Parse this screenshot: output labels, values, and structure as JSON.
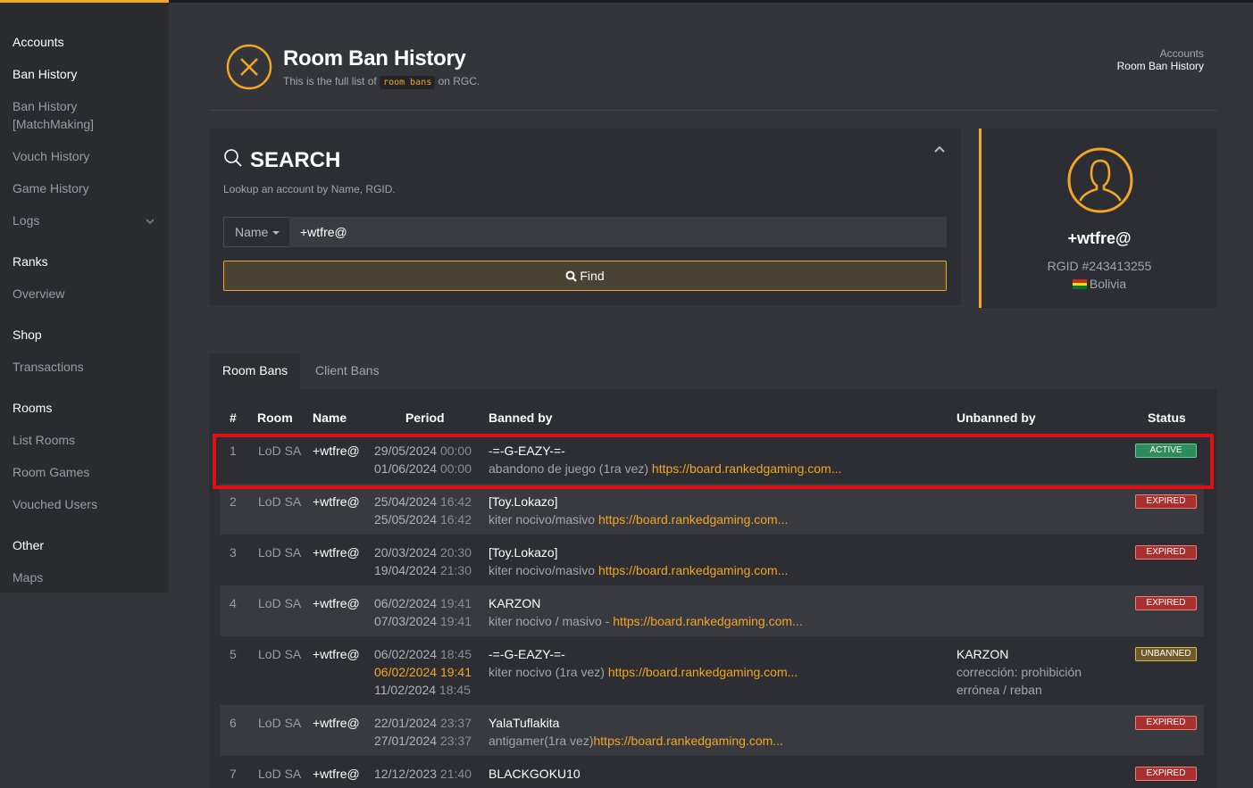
{
  "sidebar": {
    "groups": [
      {
        "heading": "Accounts",
        "items": [
          "Ban History",
          "Ban History\n[MatchMaking]",
          "Vouch History",
          "Game History",
          "Logs"
        ]
      },
      {
        "heading": "Ranks",
        "items": [
          "Overview"
        ]
      },
      {
        "heading": "Shop",
        "items": [
          "Transactions"
        ]
      },
      {
        "heading": "Rooms",
        "items": [
          "List Rooms",
          "Room Games",
          "Vouched Users"
        ]
      },
      {
        "heading": "Other",
        "items": [
          "Maps"
        ]
      }
    ],
    "active_item": "Ban History"
  },
  "header": {
    "title": "Room Ban History",
    "subtitle_pre": "This is the full list of",
    "subtitle_code": "room bans",
    "subtitle_post": "on RGC.",
    "breadcrumb": [
      "Accounts",
      "Room Ban History"
    ]
  },
  "search": {
    "title": "SEARCH",
    "description": "Lookup an account by Name, RGID.",
    "type_label": "Name",
    "input_value": "+wtfre@",
    "find_label": "Find"
  },
  "profile": {
    "name": "+wtfre@",
    "rgid": "RGID #243413255",
    "country": "Bolivia"
  },
  "tabs": [
    "Room Bans",
    "Client Bans"
  ],
  "table": {
    "headers": [
      "#",
      "Room",
      "Name",
      "Period",
      "Banned by",
      "Unbanned by",
      "Status"
    ],
    "rows": [
      {
        "num": "1",
        "room": "LoD SA",
        "name": "+wtfre@",
        "period": [
          {
            "date": "29/05/2024",
            "time": "00:00",
            "hl": false
          },
          {
            "date": "01/06/2024",
            "time": "00:00",
            "hl": false
          }
        ],
        "banned_by": "-=-G-EAZY-=-",
        "reason": "abandono de juego (1ra vez) ",
        "link": "https://board.rankedgaming.com...",
        "unbanned_by": "",
        "unban_note": "",
        "status": "ACTIVE",
        "status_type": "active"
      },
      {
        "num": "2",
        "room": "LoD SA",
        "name": "+wtfre@",
        "period": [
          {
            "date": "25/04/2024",
            "time": "16:42",
            "hl": false
          },
          {
            "date": "25/05/2024",
            "time": "16:42",
            "hl": false
          }
        ],
        "banned_by": "[Toy.Lokazo]",
        "reason": "kiter nocivo/masivo ",
        "link": "https://board.rankedgaming.com...",
        "unbanned_by": "",
        "unban_note": "",
        "status": "EXPIRED",
        "status_type": "expired"
      },
      {
        "num": "3",
        "room": "LoD SA",
        "name": "+wtfre@",
        "period": [
          {
            "date": "20/03/2024",
            "time": "20:30",
            "hl": false
          },
          {
            "date": "19/04/2024",
            "time": "21:30",
            "hl": false
          }
        ],
        "banned_by": "[Toy.Lokazo]",
        "reason": "kiter nocivo/masivo ",
        "link": "https://board.rankedgaming.com...",
        "unbanned_by": "",
        "unban_note": "",
        "status": "EXPIRED",
        "status_type": "expired"
      },
      {
        "num": "4",
        "room": "LoD SA",
        "name": "+wtfre@",
        "period": [
          {
            "date": "06/02/2024",
            "time": "19:41",
            "hl": false
          },
          {
            "date": "07/03/2024",
            "time": "19:41",
            "hl": false
          }
        ],
        "banned_by": "KARZON",
        "reason": "kiter nocivo / masivo - ",
        "link": "https://board.rankedgaming.com...",
        "unbanned_by": "",
        "unban_note": "",
        "status": "EXPIRED",
        "status_type": "expired"
      },
      {
        "num": "5",
        "room": "LoD SA",
        "name": "+wtfre@",
        "period": [
          {
            "date": "06/02/2024",
            "time": "18:45",
            "hl": false
          },
          {
            "date": "06/02/2024",
            "time": "19:41",
            "hl": true
          },
          {
            "date": "11/02/2024",
            "time": "18:45",
            "hl": false
          }
        ],
        "banned_by": "-=-G-EAZY-=-",
        "reason": "kiter nocivo (1ra vez) ",
        "link": "https://board.rankedgaming.com...",
        "unbanned_by": "KARZON",
        "unban_note": "corrección: prohibición\nerrónea / reban",
        "status": "UNBANNED",
        "status_type": "unbanned"
      },
      {
        "num": "6",
        "room": "LoD SA",
        "name": "+wtfre@",
        "period": [
          {
            "date": "22/01/2024",
            "time": "23:37",
            "hl": false
          },
          {
            "date": "27/01/2024",
            "time": "23:37",
            "hl": false
          }
        ],
        "banned_by": "YalaTuflakita",
        "reason": "antigamer(1ra vez)",
        "link": "https://board.rankedgaming.com...",
        "unbanned_by": "",
        "unban_note": "",
        "status": "EXPIRED",
        "status_type": "expired"
      },
      {
        "num": "7",
        "room": "LoD SA",
        "name": "+wtfre@",
        "period": [
          {
            "date": "12/12/2023",
            "time": "21:40",
            "hl": false
          }
        ],
        "banned_by": "BLACKGOKU10",
        "reason": "",
        "link": "",
        "unbanned_by": "",
        "unban_note": "",
        "status": "EXPIRED",
        "status_type": "expired"
      }
    ]
  },
  "colors": {
    "accent": "#f2a623",
    "highlight_box": "#e10f12"
  }
}
